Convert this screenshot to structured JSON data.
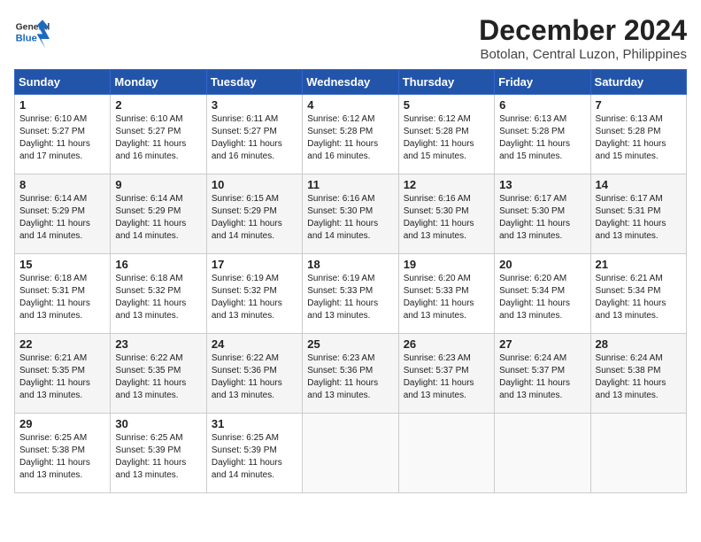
{
  "header": {
    "logo_general": "General",
    "logo_blue": "Blue",
    "month": "December 2024",
    "location": "Botolan, Central Luzon, Philippines"
  },
  "days_of_week": [
    "Sunday",
    "Monday",
    "Tuesday",
    "Wednesday",
    "Thursday",
    "Friday",
    "Saturday"
  ],
  "weeks": [
    [
      {
        "day": "1",
        "info": "Sunrise: 6:10 AM\nSunset: 5:27 PM\nDaylight: 11 hours and 17 minutes."
      },
      {
        "day": "2",
        "info": "Sunrise: 6:10 AM\nSunset: 5:27 PM\nDaylight: 11 hours and 16 minutes."
      },
      {
        "day": "3",
        "info": "Sunrise: 6:11 AM\nSunset: 5:27 PM\nDaylight: 11 hours and 16 minutes."
      },
      {
        "day": "4",
        "info": "Sunrise: 6:12 AM\nSunset: 5:28 PM\nDaylight: 11 hours and 16 minutes."
      },
      {
        "day": "5",
        "info": "Sunrise: 6:12 AM\nSunset: 5:28 PM\nDaylight: 11 hours and 15 minutes."
      },
      {
        "day": "6",
        "info": "Sunrise: 6:13 AM\nSunset: 5:28 PM\nDaylight: 11 hours and 15 minutes."
      },
      {
        "day": "7",
        "info": "Sunrise: 6:13 AM\nSunset: 5:28 PM\nDaylight: 11 hours and 15 minutes."
      }
    ],
    [
      {
        "day": "8",
        "info": "Sunrise: 6:14 AM\nSunset: 5:29 PM\nDaylight: 11 hours and 14 minutes."
      },
      {
        "day": "9",
        "info": "Sunrise: 6:14 AM\nSunset: 5:29 PM\nDaylight: 11 hours and 14 minutes."
      },
      {
        "day": "10",
        "info": "Sunrise: 6:15 AM\nSunset: 5:29 PM\nDaylight: 11 hours and 14 minutes."
      },
      {
        "day": "11",
        "info": "Sunrise: 6:16 AM\nSunset: 5:30 PM\nDaylight: 11 hours and 14 minutes."
      },
      {
        "day": "12",
        "info": "Sunrise: 6:16 AM\nSunset: 5:30 PM\nDaylight: 11 hours and 13 minutes."
      },
      {
        "day": "13",
        "info": "Sunrise: 6:17 AM\nSunset: 5:30 PM\nDaylight: 11 hours and 13 minutes."
      },
      {
        "day": "14",
        "info": "Sunrise: 6:17 AM\nSunset: 5:31 PM\nDaylight: 11 hours and 13 minutes."
      }
    ],
    [
      {
        "day": "15",
        "info": "Sunrise: 6:18 AM\nSunset: 5:31 PM\nDaylight: 11 hours and 13 minutes."
      },
      {
        "day": "16",
        "info": "Sunrise: 6:18 AM\nSunset: 5:32 PM\nDaylight: 11 hours and 13 minutes."
      },
      {
        "day": "17",
        "info": "Sunrise: 6:19 AM\nSunset: 5:32 PM\nDaylight: 11 hours and 13 minutes."
      },
      {
        "day": "18",
        "info": "Sunrise: 6:19 AM\nSunset: 5:33 PM\nDaylight: 11 hours and 13 minutes."
      },
      {
        "day": "19",
        "info": "Sunrise: 6:20 AM\nSunset: 5:33 PM\nDaylight: 11 hours and 13 minutes."
      },
      {
        "day": "20",
        "info": "Sunrise: 6:20 AM\nSunset: 5:34 PM\nDaylight: 11 hours and 13 minutes."
      },
      {
        "day": "21",
        "info": "Sunrise: 6:21 AM\nSunset: 5:34 PM\nDaylight: 11 hours and 13 minutes."
      }
    ],
    [
      {
        "day": "22",
        "info": "Sunrise: 6:21 AM\nSunset: 5:35 PM\nDaylight: 11 hours and 13 minutes."
      },
      {
        "day": "23",
        "info": "Sunrise: 6:22 AM\nSunset: 5:35 PM\nDaylight: 11 hours and 13 minutes."
      },
      {
        "day": "24",
        "info": "Sunrise: 6:22 AM\nSunset: 5:36 PM\nDaylight: 11 hours and 13 minutes."
      },
      {
        "day": "25",
        "info": "Sunrise: 6:23 AM\nSunset: 5:36 PM\nDaylight: 11 hours and 13 minutes."
      },
      {
        "day": "26",
        "info": "Sunrise: 6:23 AM\nSunset: 5:37 PM\nDaylight: 11 hours and 13 minutes."
      },
      {
        "day": "27",
        "info": "Sunrise: 6:24 AM\nSunset: 5:37 PM\nDaylight: 11 hours and 13 minutes."
      },
      {
        "day": "28",
        "info": "Sunrise: 6:24 AM\nSunset: 5:38 PM\nDaylight: 11 hours and 13 minutes."
      }
    ],
    [
      {
        "day": "29",
        "info": "Sunrise: 6:25 AM\nSunset: 5:38 PM\nDaylight: 11 hours and 13 minutes."
      },
      {
        "day": "30",
        "info": "Sunrise: 6:25 AM\nSunset: 5:39 PM\nDaylight: 11 hours and 13 minutes."
      },
      {
        "day": "31",
        "info": "Sunrise: 6:25 AM\nSunset: 5:39 PM\nDaylight: 11 hours and 14 minutes."
      },
      {
        "day": "",
        "info": ""
      },
      {
        "day": "",
        "info": ""
      },
      {
        "day": "",
        "info": ""
      },
      {
        "day": "",
        "info": ""
      }
    ]
  ]
}
